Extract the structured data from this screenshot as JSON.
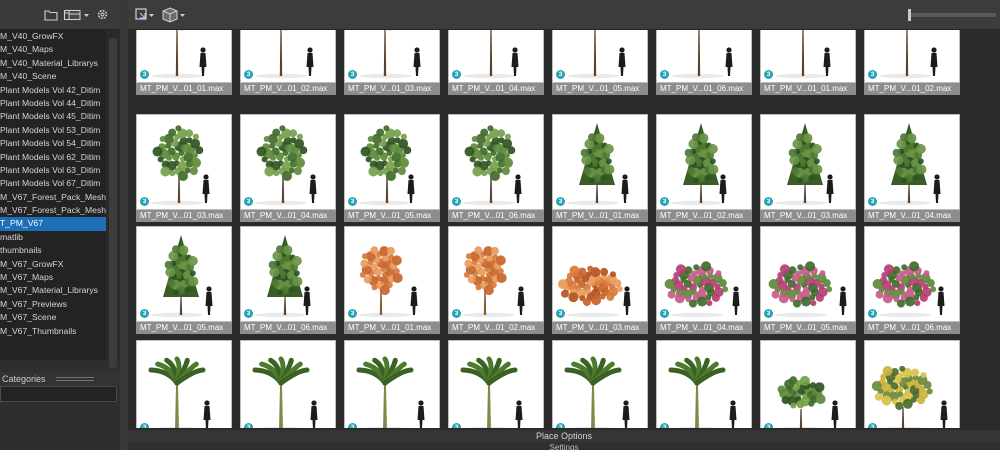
{
  "left_toolbar": {
    "icons": [
      "folder-icon",
      "new-folder-icon",
      "layout-icon",
      "gear-icon"
    ]
  },
  "tree": {
    "items": [
      {
        "label": "M_V40_GrowFX",
        "selected": false
      },
      {
        "label": "M_V40_Maps",
        "selected": false
      },
      {
        "label": "M_V40_Material_Librarys",
        "selected": false
      },
      {
        "label": "M_V40_Scene",
        "selected": false
      },
      {
        "label": "Plant Models Vol 42_Ditim",
        "selected": false
      },
      {
        "label": "Plant Models Vol 44_Ditim",
        "selected": false
      },
      {
        "label": "Plant Models Vol 45_Ditim",
        "selected": false
      },
      {
        "label": "Plant Models Vol 53_Ditim",
        "selected": false
      },
      {
        "label": "Plant Models Vol 54_Ditim",
        "selected": false
      },
      {
        "label": "Plant Models Vol 62_Ditim",
        "selected": false
      },
      {
        "label": "Plant Models Vol 63_Ditim",
        "selected": false
      },
      {
        "label": "Plant Models Vol 67_Ditim",
        "selected": false
      },
      {
        "label": "M_V67_Forest_Pack_Mesh_(",
        "selected": false
      },
      {
        "label": "M_V67_Forest_Pack_Mesh_1",
        "selected": false
      },
      {
        "label": "T_PM_V67",
        "selected": true
      },
      {
        "label": " matlib",
        "selected": false
      },
      {
        "label": " thumbnails",
        "selected": false
      },
      {
        "label": "M_V67_GrowFX",
        "selected": false
      },
      {
        "label": "M_V67_Maps",
        "selected": false
      },
      {
        "label": "M_V67_Material_Librarys",
        "selected": false
      },
      {
        "label": "M_V67_Previews",
        "selected": false
      },
      {
        "label": "M_V67_Scene",
        "selected": false
      },
      {
        "label": "M_V67_Thumbnails",
        "selected": false
      }
    ]
  },
  "categories": {
    "header": "Categories"
  },
  "main_toolbar": {
    "icons": [
      "refresh-icon",
      "cube-icon"
    ]
  },
  "grid": {
    "badge_label": "3",
    "rows": [
      [
        {
          "label": "MT_PM_V...01_01.max",
          "kind": "blossom"
        },
        {
          "label": "MT_PM_V...01_02.max",
          "kind": "blossom"
        },
        {
          "label": "MT_PM_V...01_03.max",
          "kind": "blossom"
        },
        {
          "label": "MT_PM_V...01_04.max",
          "kind": "broad"
        },
        {
          "label": "MT_PM_V...01_05.max",
          "kind": "broad"
        },
        {
          "label": "MT_PM_V...01_06.max",
          "kind": "broad_pink"
        },
        {
          "label": "MT_PM_V...01_01.max",
          "kind": "broad"
        },
        {
          "label": "MT_PM_V...01_02.max",
          "kind": "broad"
        }
      ],
      [
        {
          "label": "MT_PM_V...01_03.max",
          "kind": "round"
        },
        {
          "label": "MT_PM_V...01_04.max",
          "kind": "round"
        },
        {
          "label": "MT_PM_V...01_05.max",
          "kind": "round"
        },
        {
          "label": "MT_PM_V...01_06.max",
          "kind": "round"
        },
        {
          "label": "MT_PM_V...01_01.max",
          "kind": "conifer"
        },
        {
          "label": "MT_PM_V...01_02.max",
          "kind": "conifer"
        },
        {
          "label": "MT_PM_V...01_03.max",
          "kind": "conifer"
        },
        {
          "label": "MT_PM_V...01_04.max",
          "kind": "conifer"
        }
      ],
      [
        {
          "label": "MT_PM_V...01_05.max",
          "kind": "conifer"
        },
        {
          "label": "MT_PM_V...01_06.max",
          "kind": "conifer"
        },
        {
          "label": "MT_PM_V...01_01.max",
          "kind": "orange_sparse"
        },
        {
          "label": "MT_PM_V...01_02.max",
          "kind": "orange_sparse"
        },
        {
          "label": "MT_PM_V...01_03.max",
          "kind": "orange_bush"
        },
        {
          "label": "MT_PM_V...01_04.max",
          "kind": "pink_bush"
        },
        {
          "label": "MT_PM_V...01_05.max",
          "kind": "pink_bush"
        },
        {
          "label": "MT_PM_V...01_06.max",
          "kind": "pink_bush"
        }
      ],
      [
        {
          "label": "",
          "kind": "banana"
        },
        {
          "label": "",
          "kind": "banana"
        },
        {
          "label": "",
          "kind": "banana"
        },
        {
          "label": "",
          "kind": "banana"
        },
        {
          "label": "",
          "kind": "banana"
        },
        {
          "label": "",
          "kind": "banana"
        },
        {
          "label": "",
          "kind": "round_small"
        },
        {
          "label": "",
          "kind": "yellow_bush"
        }
      ]
    ]
  },
  "footer": {
    "place_options": "Place Options",
    "settings": "Settings"
  },
  "colors": {
    "selection": "#1d6fb7",
    "label_bg": "#8d8d8d",
    "badge": "#29a3b3"
  }
}
